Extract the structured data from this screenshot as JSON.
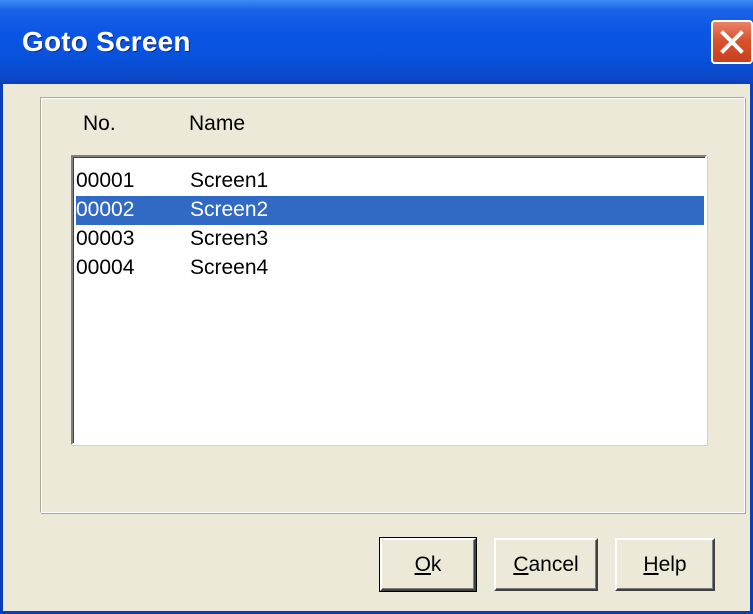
{
  "window": {
    "title": "Goto Screen"
  },
  "titlebar": {
    "close_icon": "close-x-icon",
    "accent": "#0b55e4",
    "close_color": "#d8532e"
  },
  "list": {
    "headers": {
      "no": "No.",
      "name": "Name"
    },
    "rows": [
      {
        "no": "00001",
        "name": "Screen1",
        "selected": false
      },
      {
        "no": "00002",
        "name": "Screen2",
        "selected": true
      },
      {
        "no": "00003",
        "name": "Screen3",
        "selected": false
      },
      {
        "no": "00004",
        "name": "Screen4",
        "selected": false
      }
    ],
    "selection_color": "#316ac5"
  },
  "buttons": {
    "ok": {
      "mnemonic": "O",
      "rest": "k"
    },
    "cancel": {
      "mnemonic": "C",
      "rest": "ancel"
    },
    "help": {
      "mnemonic": "H",
      "rest": "elp"
    }
  }
}
